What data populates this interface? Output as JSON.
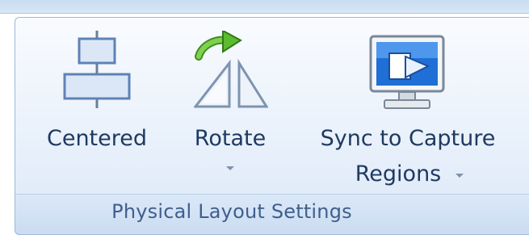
{
  "ribbon": {
    "group_label": "Physical Layout Settings",
    "buttons": {
      "centered": {
        "label": "Centered",
        "icon": "centered-layout-icon"
      },
      "rotate": {
        "label": "Rotate",
        "icon": "rotate-icon",
        "has_dropdown": true
      },
      "sync": {
        "label_line1": "Sync to Capture",
        "label_line2": "Regions",
        "icon": "monitor-sync-icon",
        "has_dropdown": true
      }
    }
  },
  "colors": {
    "group_border": "#9db8d9",
    "label_text": "#1f3a61",
    "group_label_text": "#3f5f8d"
  }
}
